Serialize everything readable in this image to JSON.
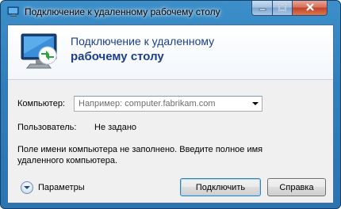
{
  "window": {
    "title": "Подключение к удаленному рабочему столу"
  },
  "banner": {
    "title_line1": "Подключение к удаленному",
    "title_line2": "рабочему столу",
    "icon": "remote-desktop-monitor-icon"
  },
  "form": {
    "computer_label": "Компьютер:",
    "computer_placeholder": "Например: computer.fabrikam.com",
    "user_label": "Пользователь:",
    "user_value": "Не задано",
    "message": "Поле имени компьютера не заполнено. Введите полное имя удаленного компьютера."
  },
  "footer": {
    "options_label": "Параметры",
    "connect_label": "Подключить",
    "help_label": "Справка"
  },
  "colors": {
    "frame": "#2f7fbe",
    "banner_title": "#1c3e8a",
    "close_button": "#c3442b"
  }
}
